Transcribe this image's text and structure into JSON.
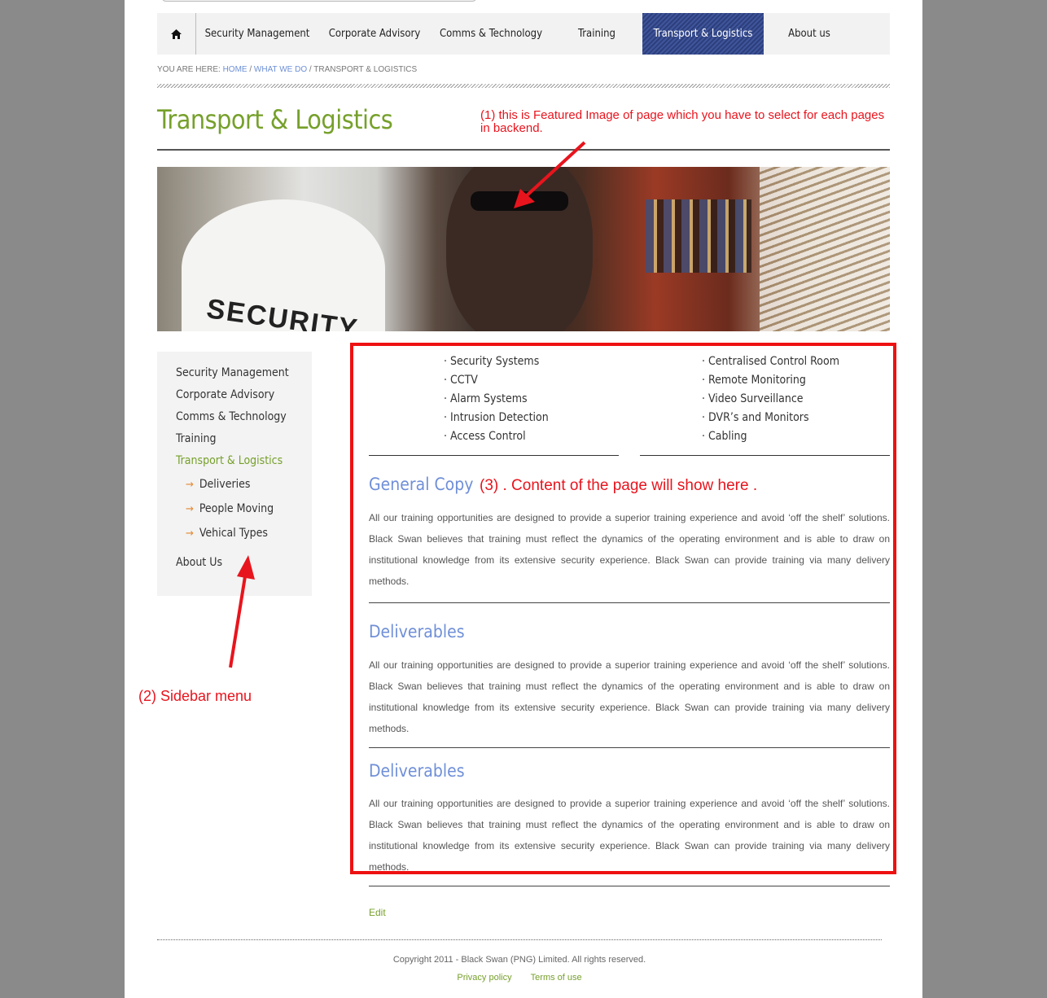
{
  "nav": {
    "items": [
      {
        "label": "Security Management"
      },
      {
        "label": "Corporate Advisory"
      },
      {
        "label": "Comms & Technology"
      },
      {
        "label": "Training"
      },
      {
        "label": "Transport & Logistics"
      },
      {
        "label": "About us"
      }
    ],
    "active_index": 4
  },
  "breadcrumb": {
    "prefix": "YOU ARE HERE: ",
    "home": "HOME",
    "sep1": " / ",
    "what": "WHAT WE DO",
    "sep2": " / ",
    "current": "TRANSPORT & LOGISTICS"
  },
  "page_title": "Transport & Logistics",
  "annotations": {
    "featured": "(1) this is Featured Image of page which you have to select for each pages in backend.",
    "sidebar": "(2) Sidebar menu",
    "content": "(3) . Content of the page will show here ."
  },
  "featured_image": {
    "shirt_text": "SECURITY"
  },
  "sidebar": {
    "items": [
      {
        "label": "Security Management"
      },
      {
        "label": "Corporate Advisory"
      },
      {
        "label": "Comms & Technology"
      },
      {
        "label": "Training"
      },
      {
        "label": "Transport & Logistics"
      }
    ],
    "sub_items": [
      {
        "label": "Deliveries"
      },
      {
        "label": "People Moving"
      },
      {
        "label": "Vehical Types"
      }
    ],
    "last_item": "About Us"
  },
  "services": {
    "left": [
      "Security Systems",
      "CCTV",
      "Alarm Systems",
      "Intrusion Detection",
      "Access Control"
    ],
    "right": [
      "Centralised Control Room",
      "Remote Monitoring",
      "Video Surveillance",
      "DVR’s and Monitors",
      "Cabling"
    ]
  },
  "sections": [
    {
      "title": "General Copy",
      "body": "All our training opportunities are designed to provide a superior training experience and avoid ‘off the shelf’ solutions. Black Swan believes that training must reflect the dynamics of the operating environment and is able to draw on institutional knowledge from its extensive security experience. Black Swan can provide training via many delivery methods."
    },
    {
      "title": "Deliverables",
      "body": "All our training opportunities are designed to provide a superior training experience and avoid ‘off the shelf’ solutions. Black Swan believes that training must reflect the dynamics of the operating environment and is able to draw on institutional knowledge from its extensive security experience. Black Swan can provide training via many delivery methods."
    },
    {
      "title": "Deliverables",
      "body": "All our training opportunities are designed to provide a superior training experience and avoid ‘off the shelf’ solutions. Black Swan believes that training must reflect the dynamics of the operating environment and is able to draw on institutional knowledge from its extensive security experience. Black Swan can provide training via many delivery methods."
    }
  ],
  "edit_label": "Edit",
  "footer": {
    "copyright": "Copyright 2011 - Black Swan (PNG) Limited. All rights reserved.",
    "privacy": "Privacy policy",
    "terms": "Terms of use"
  },
  "colors": {
    "accent_green": "#76a02b",
    "heading_blue": "#6f8fd8",
    "annotation_red": "#e8141d",
    "nav_active": "#2d3f7c"
  }
}
